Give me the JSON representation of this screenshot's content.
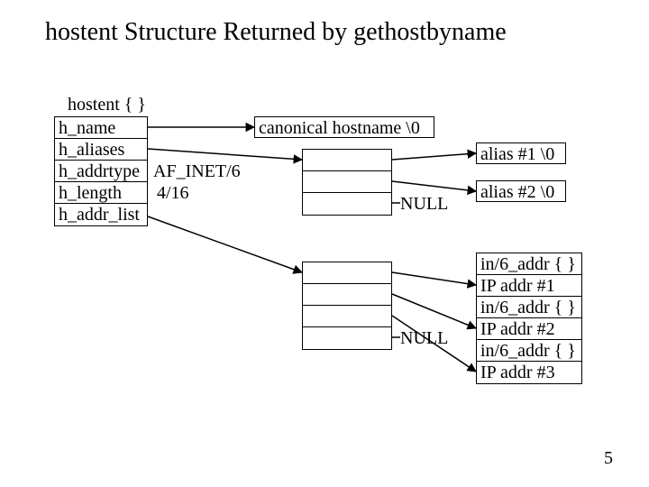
{
  "title": "hostent Structure Returned by gethostbyname",
  "struct_caption": "hostent { }",
  "struct_fields": [
    "h_name",
    "h_aliases",
    "h_addrtype",
    "h_length",
    "h_addr_list"
  ],
  "addrtype_value": "AF_INET/6",
  "length_value": "4/16",
  "canonical_label": "canonical hostname \\0",
  "alias_labels": [
    "alias #1 \\0",
    "alias #2 \\0"
  ],
  "null_label_1": "NULL",
  "null_label_2": "NULL",
  "addr_labels": [
    "in/6_addr { }",
    "IP addr #1",
    "in/6_addr { }",
    "IP addr #2",
    "in/6_addr { }",
    "IP addr #3"
  ],
  "page_number": "5"
}
